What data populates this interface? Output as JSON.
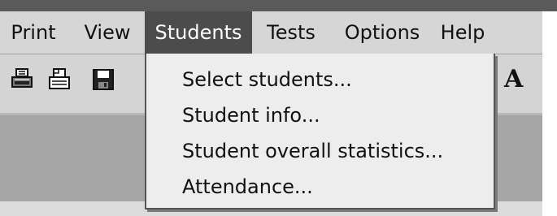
{
  "menubar": {
    "items": [
      {
        "label": "Print"
      },
      {
        "label": "View"
      },
      {
        "label": "Students"
      },
      {
        "label": "Tests"
      },
      {
        "label": "Options"
      },
      {
        "label": "Help"
      }
    ],
    "active_item": "Students"
  },
  "toolbar": {
    "icons": [
      "printer-icon",
      "print-preview-icon",
      "save-icon"
    ],
    "font_button_label": "A"
  },
  "students_menu": {
    "items": [
      {
        "label": "Select students..."
      },
      {
        "label": "Student info..."
      },
      {
        "label": "Student overall statistics..."
      },
      {
        "label": "Attendance..."
      }
    ]
  },
  "colors": {
    "menubar_bg": "#d6d6d6",
    "active_menu_bg": "#4c4c4c",
    "dropdown_bg": "#ededed",
    "content_bg": "#a6a6a6"
  }
}
